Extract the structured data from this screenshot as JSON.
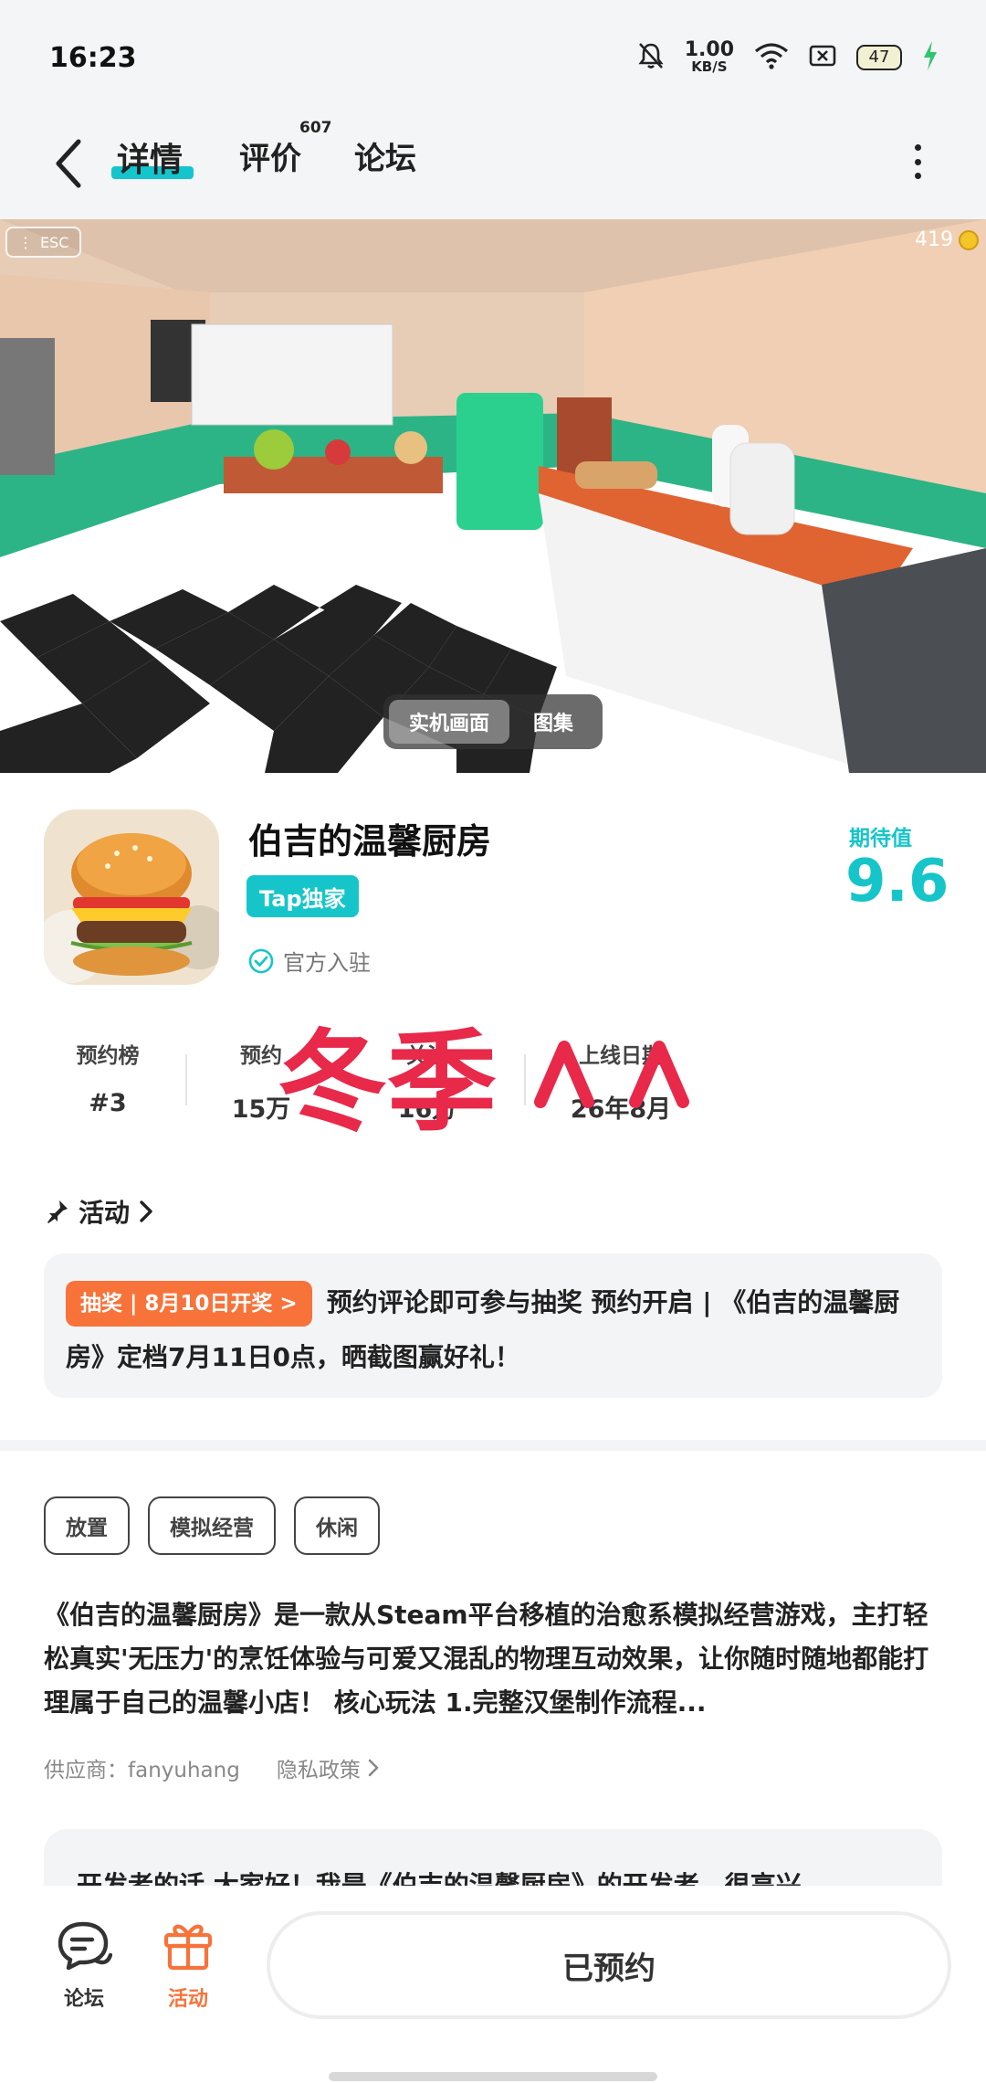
{
  "status_bar": {
    "time": "16:23",
    "net_speed": "1.00",
    "net_unit": "KB/S",
    "battery": "47"
  },
  "header": {
    "tabs": [
      {
        "label": "详情"
      },
      {
        "label": "评价",
        "count": "607"
      },
      {
        "label": "论坛"
      }
    ]
  },
  "media": {
    "esc_label": "ESC",
    "coins": "419",
    "switch_active": "实机画面",
    "switch_other": "图集"
  },
  "app": {
    "title": "伯吉的温馨厨房",
    "badge": "Tap独家",
    "official": "官方入驻",
    "score_label": "期待值",
    "score": "9.6"
  },
  "stats": [
    {
      "label": "预约榜",
      "value": "#3"
    },
    {
      "label": "预约",
      "value": "15万"
    },
    {
      "label": "关注",
      "value": "16万"
    },
    {
      "label": "上线日期",
      "value": "26年8月"
    }
  ],
  "sticker": {
    "text": "冬季"
  },
  "activity": {
    "header": "活动",
    "tag": "抽奖 | 8月10日开奖 >",
    "text": "预约评论即可参与抽奖 预约开启 | 《伯吉的温馨厨房》定档7月11日0点，晒截图赢好礼！"
  },
  "tags": [
    "放置",
    "模拟经营",
    "休闲"
  ],
  "description": "《伯吉的温馨厨房》是一款从Steam平台移植的治愈系模拟经营游戏，主打轻松真实'无压力'的烹饪体验与可爱又混乱的物理互动效果，让你随时随地都能打理属于自己的温馨小店！ 核心玩法 1.完整汉堡制作流程...",
  "supplier": "供应商：fanyuhang",
  "privacy": "隐私政策",
  "dev_note": "开发者的话 大家好！我是《伯吉的温馨厨房》的开发者，很高兴",
  "bottom": {
    "forum": "论坛",
    "activity": "活动",
    "reserved": "已预约"
  },
  "colors": {
    "accent": "#16c5c9",
    "orange": "#f7733a"
  }
}
